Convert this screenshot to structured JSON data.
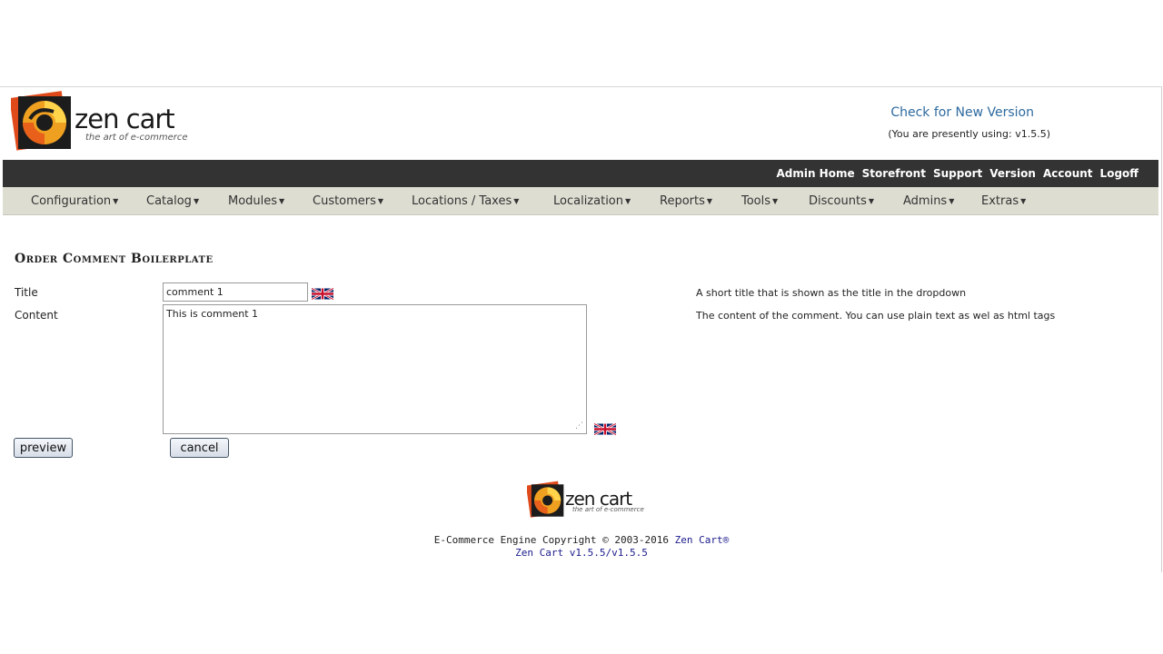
{
  "header": {
    "logo_word": "zen cart",
    "logo_tagline": "the art of e-commerce",
    "check_version_link": "Check for New Version",
    "version_note": "(You are presently using: v1.5.5)"
  },
  "topbar": {
    "links": [
      "Admin Home",
      "Storefront",
      "Support",
      "Version",
      "Account",
      "Logoff"
    ]
  },
  "menu": {
    "items": [
      "Configuration",
      "Catalog",
      "Modules",
      "Customers",
      "Locations / Taxes",
      "Localization",
      "Reports",
      "Tools",
      "Discounts",
      "Admins",
      "Extras"
    ]
  },
  "page": {
    "title": "Order Comment Boilerplate"
  },
  "form": {
    "title_label": "Title",
    "title_value": "comment 1",
    "title_help": "A short title that is shown as the title in the dropdown",
    "content_label": "Content",
    "content_value": "This is comment 1",
    "content_help": "The content of the comment. You can use plain text as wel as html tags",
    "language_flag": "uk-flag-icon",
    "preview_button": "preview",
    "cancel_button": "cancel"
  },
  "footer": {
    "copyright": "E-Commerce Engine Copyright © 2003-2016",
    "brand_link": "Zen Cart®",
    "version_link": "Zen Cart v1.5.5/v1.5.5"
  },
  "colors": {
    "topbar_bg": "#333333",
    "menubar_bg": "#deddd2",
    "link_blue": "#2d6a9f"
  }
}
